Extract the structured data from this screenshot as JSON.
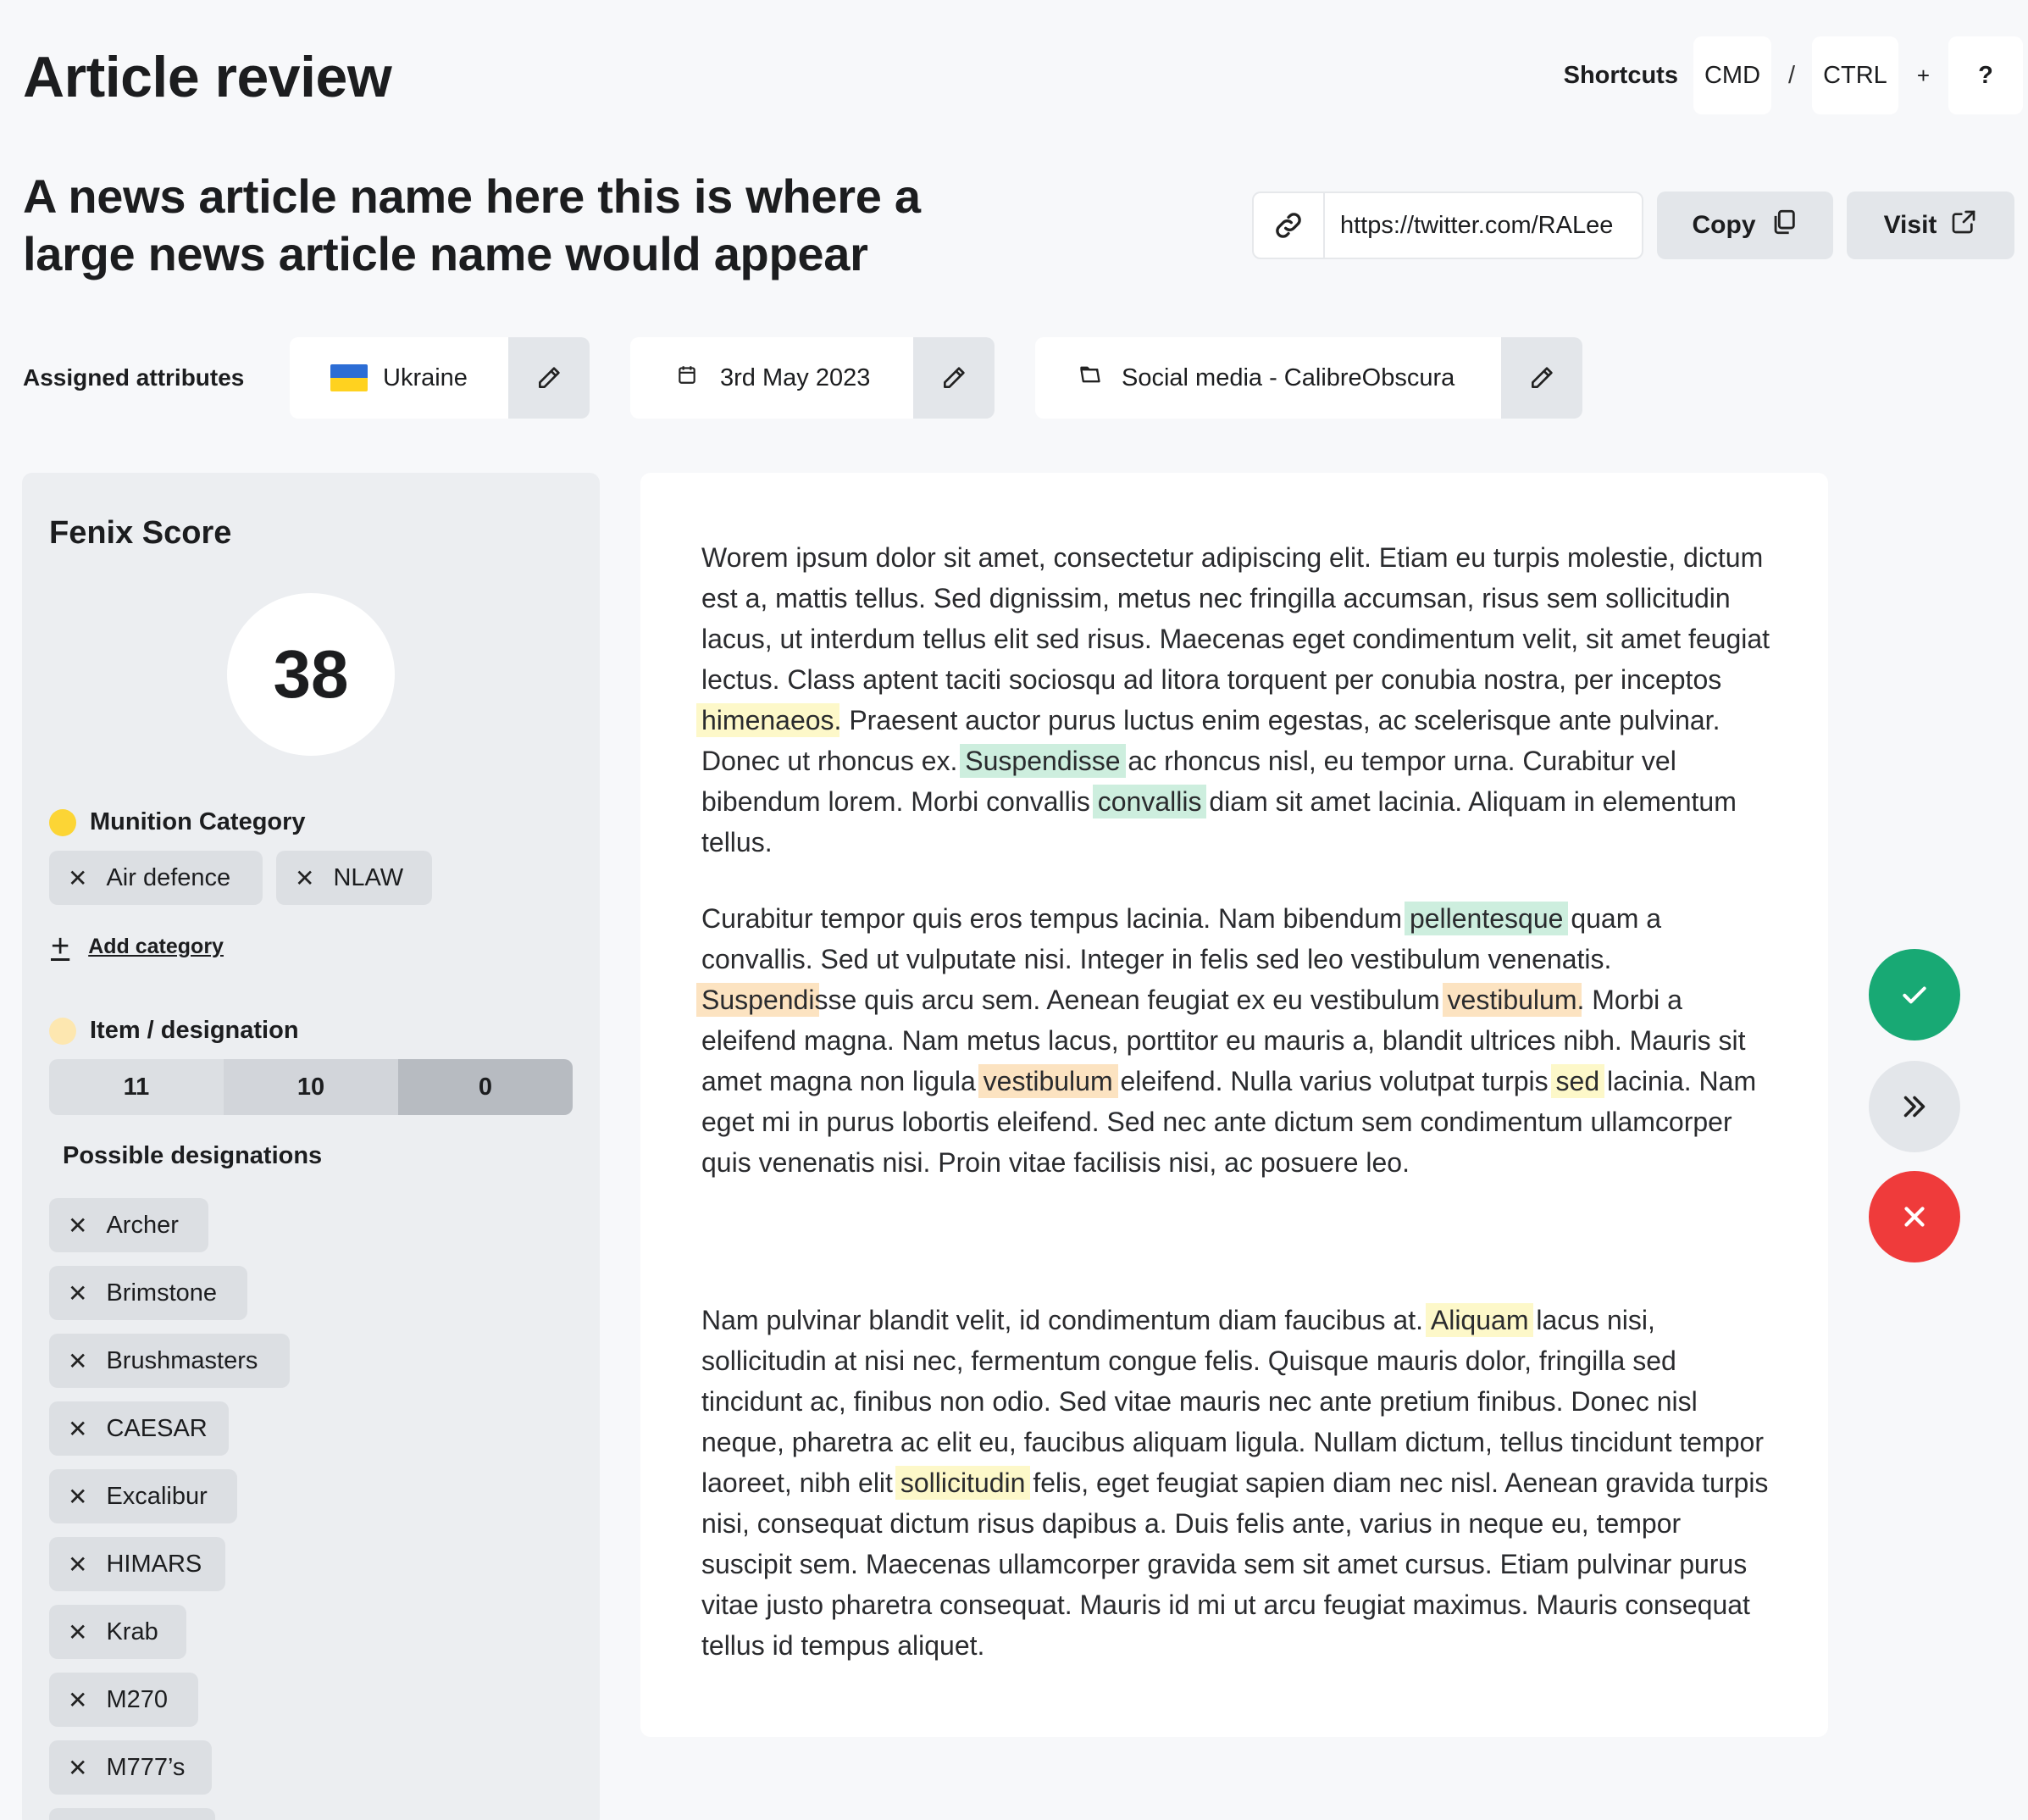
{
  "header": {
    "title": "Article review",
    "shortcuts": {
      "label": "Shortcuts",
      "cmd": "CMD",
      "slash": "/",
      "ctrl": "CTRL",
      "plus": "+",
      "help": "?"
    }
  },
  "article": {
    "title": "A news article name here this is where a large news article name would appear",
    "url": "https://twitter.com/RALee",
    "copy_label": "Copy",
    "visit_label": "Visit"
  },
  "attributes": {
    "label": "Assigned attributes",
    "country": "Ukraine",
    "date": "3rd May 2023",
    "source": "Social media - CalibreObscura"
  },
  "sidebar": {
    "title": "Fenix Score",
    "score": "38",
    "munition_title": "Munition Category",
    "munition_chips": [
      "Air defence",
      "NLAW"
    ],
    "add_category": "Add category",
    "item_title": "Item / designation",
    "segments": [
      "11",
      "10",
      "0"
    ],
    "possible_title": "Possible designations",
    "designations": [
      "Archer",
      "Brimstone",
      "Brushmasters",
      "CAESAR",
      "Excalibur",
      "HIMARS",
      "Krab",
      "M270",
      "M777’s"
    ]
  },
  "body": {
    "p1": [
      {
        "t": "Worem ipsum dolor sit amet, consectetur adipiscing elit. Etiam eu turpis molestie, dictum est a, mattis tellus. Sed dignissim, metus nec fringilla accumsan, risus sem sollicitudin lacus, ut interdum tellus elit sed risus. Maecenas eget condimentum velit, sit amet feugiat lectus. Class aptent taciti sociosqu ad litora torquent per conubia nostra, per inceptos "
      },
      {
        "t": "himenaeos",
        "h": "y"
      },
      {
        "t": ". Praesent auctor purus luctus enim egestas, ac scelerisque ante pulvinar. Donec ut rhoncus ex. "
      },
      {
        "t": "Suspendisse",
        "h": "g"
      },
      {
        "t": " ac rhoncus nisl, eu tempor urna. Curabitur vel bibendum lorem. Morbi convallis "
      },
      {
        "t": "convallis",
        "h": "g"
      },
      {
        "t": " diam sit amet lacinia. Aliquam in elementum tellus."
      }
    ],
    "p2": [
      {
        "t": "Curabitur tempor quis eros tempus lacinia. Nam bibendum "
      },
      {
        "t": "pellentesque",
        "h": "g"
      },
      {
        "t": " quam a convallis. Sed ut vulputate nisi. Integer in felis sed leo vestibulum venenatis. "
      },
      {
        "t": "Suspendi",
        "h": "o"
      },
      {
        "t": "sse quis arcu sem. Aenean feugiat ex eu vestibulum "
      },
      {
        "t": "vestibulum",
        "h": "o"
      },
      {
        "t": ". Morbi a eleifend magna. Nam metus lacus, porttitor eu mauris a, blandit ultrices nibh. Mauris sit amet magna non ligula "
      },
      {
        "t": "vestibulum",
        "h": "o"
      },
      {
        "t": " eleifend. Nulla varius volutpat turpis "
      },
      {
        "t": "sed",
        "h": "y"
      },
      {
        "t": " lacinia. Nam eget mi in purus lobortis eleifend. Sed nec ante dictum sem condimentum ullamcorper quis venenatis nisi. Proin vitae facilisis nisi, ac posuere leo."
      }
    ],
    "p3": [
      {
        "t": "Nam pulvinar blandit velit, id condimentum diam faucibus at. "
      },
      {
        "t": "Aliquam",
        "h": "y"
      },
      {
        "t": " lacus nisi, sollicitudin at nisi nec, fermentum congue felis. Quisque mauris dolor, fringilla sed tincidunt ac, finibus non odio. Sed vitae mauris nec ante pretium finibus. Donec nisl neque, pharetra ac elit eu, faucibus aliquam ligula. Nullam dictum, tellus tincidunt tempor laoreet, nibh elit "
      },
      {
        "t": "sollicitudin",
        "h": "y"
      },
      {
        "t": " felis, eget feugiat sapien diam nec nisl. Aenean gravida turpis nisi, consequat dictum risus dapibus a. Duis felis ante, varius in neque eu, tempor suscipit sem. Maecenas ullamcorper gravida sem sit amet cursus. Etiam pulvinar purus vitae justo pharetra consequat. Mauris id mi ut arcu feugiat maximus. Mauris consequat tellus id tempus aliquet."
      }
    ]
  },
  "colors": {
    "munition_dot": "#fcd535",
    "item_dot": "#fde7b0",
    "approve": "#18a974",
    "reject": "#ef3b3b"
  },
  "icons": {
    "link": "link-icon",
    "copy": "copy-icon",
    "external": "external-link-icon",
    "edit": "pencil-icon",
    "calendar": "calendar-icon",
    "folder": "folder-icon",
    "approve": "check-icon",
    "skip": "double-chevron-right-icon",
    "reject": "close-icon"
  }
}
